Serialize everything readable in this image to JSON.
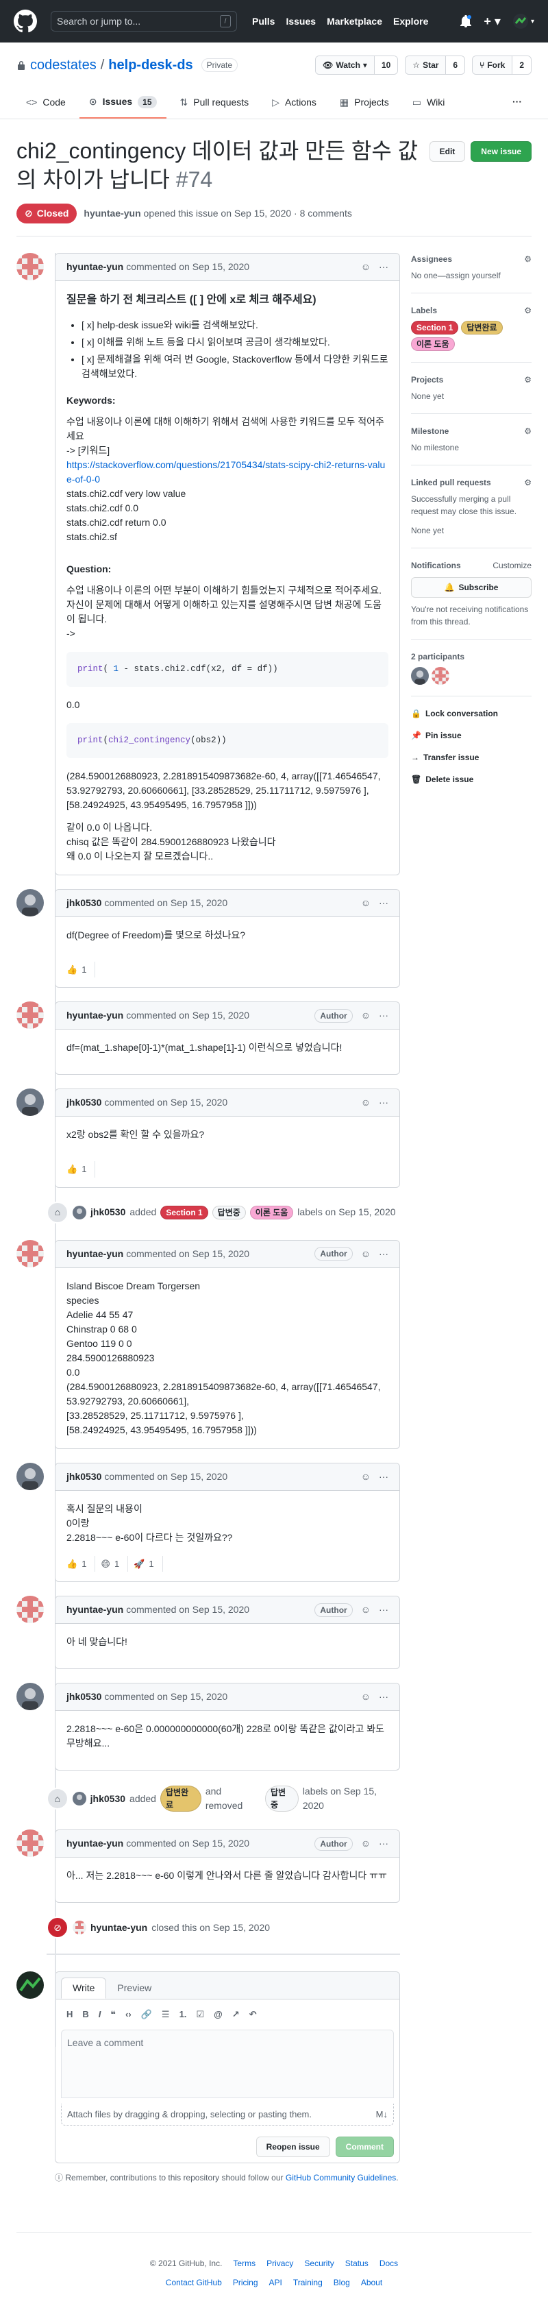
{
  "header": {
    "search_placeholder": "Search or jump to...",
    "search_key": "/",
    "nav": [
      "Pulls",
      "Issues",
      "Marketplace",
      "Explore"
    ]
  },
  "repo": {
    "owner": "codestates",
    "sep": "/",
    "name": "help-desk-ds",
    "visibility": "Private",
    "watch_label": "Watch",
    "watch_count": "10",
    "star_label": "Star",
    "star_count": "6",
    "fork_label": "Fork",
    "fork_count": "2",
    "tabs": [
      {
        "label": "Code"
      },
      {
        "label": "Issues",
        "count": "15"
      },
      {
        "label": "Pull requests"
      },
      {
        "label": "Actions"
      },
      {
        "label": "Projects"
      },
      {
        "label": "Wiki"
      }
    ],
    "more": "···"
  },
  "issue": {
    "title": "chi2_contingency 데이터 값과 만든 함수 값의 차이가 납니다",
    "number": "#74",
    "edit_label": "Edit",
    "new_issue_label": "New issue",
    "state": "Closed",
    "opener": "hyuntae-yun",
    "opened_text": "opened this issue on Sep 15, 2020 · 8 comments"
  },
  "first_comment": {
    "author": "hyuntae-yun",
    "meta": "commented on Sep 15, 2020",
    "heading": "질문을 하기 전 체크리스트 ([ ] 안에 x로 체크 해주세요)",
    "checklist": [
      "[ x] help-desk issue와 wiki를 검색해보았다.",
      "[ x] 이해를 위해 노트 등을 다시 읽어보며 공금이 생각해보았다.",
      "[ x] 문제해결을 위해 여러 번 Google, Stackoverflow 등에서 다양한 키워드로 검색해보았다."
    ],
    "keywords_heading": "Keywords:",
    "keywords_intro": "수업 내용이나 이론에 대해 이해하기 위해서 검색에 사용한 키워드를 모두 적어주세요",
    "keywords_arrow": "-> [키워드]",
    "keywords_link": "https://stackoverflow.com/questions/21705434/stats-scipy-chi2-returns-value-of-0-0",
    "keywords": [
      "stats.chi2.cdf very low value",
      "stats.chi2.cdf 0.0",
      "stats.chi2.cdf return 0.0",
      "stats.chi2.sf"
    ],
    "question_heading": "Question:",
    "question_text": "수업 내용이나 이론의 어떤 부분이 이해하기 힘들었는지 구체적으로 적어주세요. 자신이 문제에 대해서 어떻게 이해하고 있는지를 설명해주시면 답변 채공에 도움이 됩니다.",
    "question_arrow": "->",
    "code1": {
      "a": "print",
      "b": "( ",
      "c": "1",
      "d": " - stats.chi2.cdf(x2, df = df))"
    },
    "result1": "0.0",
    "code2": {
      "a": "print",
      "b": "(",
      "c": "chi2_contingency",
      "d": "(obs2))"
    },
    "result2": "(284.5900126880923, 2.2818915409873682e-60, 4, array([[71.46546547, 53.92792793, 20.60660661], [33.28528529, 25.11711712, 9.5975976 ], [58.24924925, 43.95495495, 16.7957958 ]]))",
    "closing": [
      "같이 0.0 이 나옵니다.",
      "chisq 값은 똑같이 284.5900126880923 나왔습니다",
      "왜 0.0 이 나오는지 잘 모르겠습니다.."
    ]
  },
  "comments": [
    {
      "author": "jhk0530",
      "meta": "commented on Sep 15, 2020",
      "role": "",
      "lines": [
        "df(Degree of Freedom)를 몇으로 하셨나요?"
      ],
      "reactions": [
        {
          "emoji": "👍",
          "count": "1"
        }
      ]
    },
    {
      "author": "hyuntae-yun",
      "meta": "commented on Sep 15, 2020",
      "role": "Author",
      "lines": [
        "df=(mat_1.shape[0]-1)*(mat_1.shape[1]-1) 이런식으로 넣었습니다!"
      ],
      "reactions": []
    },
    {
      "author": "jhk0530",
      "meta": "commented on Sep 15, 2020",
      "role": "",
      "lines": [
        "x2랑 obs2를 확인 할 수 있을까요?"
      ],
      "reactions": [
        {
          "emoji": "👍",
          "count": "1"
        }
      ]
    }
  ],
  "label_event1": {
    "actor": "jhk0530",
    "verb": "added",
    "labels": [
      "Section 1",
      "답변중",
      "이론 도움"
    ],
    "tail": "labels on Sep 15, 2020"
  },
  "comment_data": {
    "author": "hyuntae-yun",
    "meta": "commented on Sep 15, 2020",
    "role": "Author",
    "lines": [
      "Island Biscoe Dream Torgersen",
      "species",
      "Adelie 44 55 47",
      "Chinstrap 0 68 0",
      "Gentoo 119 0 0",
      "284.5900126880923",
      "0.0",
      "(284.5900126880923, 2.2818915409873682e-60, 4, array([[71.46546547, 53.92792793, 20.60660661],",
      "[33.28528529, 25.11711712, 9.5975976 ],",
      "[58.24924925, 43.95495495, 16.7957958 ]]))"
    ]
  },
  "comments2": [
    {
      "author": "jhk0530",
      "meta": "commented on Sep 15, 2020",
      "role": "",
      "lines": [
        "혹시 질문의 내용이",
        "0이랑",
        "2.2818~~~ e-60이 다르다 는 것일까요??"
      ],
      "reactions": [
        {
          "emoji": "👍",
          "count": "1"
        },
        {
          "emoji": "😄",
          "count": "1"
        },
        {
          "emoji": "🚀",
          "count": "1"
        }
      ]
    },
    {
      "author": "hyuntae-yun",
      "meta": "commented on Sep 15, 2020",
      "role": "Author",
      "lines": [
        "아 네 맞습니다!"
      ],
      "reactions": []
    },
    {
      "author": "jhk0530",
      "meta": "commented on Sep 15, 2020",
      "role": "",
      "lines": [
        "2.2818~~~ e-60은 0.000000000000(60개) 228로 0이랑 똑같은 값이라고 봐도 무방해요..."
      ],
      "reactions": []
    }
  ],
  "label_event2": {
    "actor": "jhk0530",
    "added": "added",
    "label_added": "답변완료",
    "removed": "and removed",
    "label_removed": "답변중",
    "tail": "labels on Sep 15, 2020"
  },
  "last_comment": {
    "author": "hyuntae-yun",
    "meta": "commented on Sep 15, 2020",
    "role": "Author",
    "lines": [
      "아... 저는 2.2818~~~ e-60 이렇게 안나와서 다른 줄 알았습니다 감사합니다 ㅠㅠ"
    ]
  },
  "close_event": {
    "actor": "hyuntae-yun",
    "text": "closed this on Sep 15, 2020"
  },
  "new_comment": {
    "tab_write": "Write",
    "tab_preview": "Preview",
    "toolbar": [
      "H",
      "B",
      "I",
      "❝",
      "‹›",
      "🔗",
      "☰",
      "1.",
      "☑",
      "@",
      "↗",
      "↶"
    ],
    "placeholder": "Leave a comment",
    "hint": "Attach files by dragging & dropping, selecting or pasting them.",
    "reopen_label": "Reopen issue",
    "comment_label": "Comment",
    "remember_prefix": "Remember, contributions to this repository should follow our",
    "remember_link": "GitHub Community Guidelines",
    "remember_suffix": "."
  },
  "sidebar": {
    "assignees_title": "Assignees",
    "assignees_value": "No one—assign yourself",
    "labels_title": "Labels",
    "labels": [
      "Section 1",
      "답변완료",
      "이론 도움"
    ],
    "projects_title": "Projects",
    "projects_value": "None yet",
    "milestone_title": "Milestone",
    "milestone_value": "No milestone",
    "linked_title": "Linked pull requests",
    "linked_desc": "Successfully merging a pull request may close this issue.",
    "linked_value": "None yet",
    "notifications_title": "Notifications",
    "customize": "Customize",
    "subscribe_label": "Subscribe",
    "notif_desc": "You're not receiving notifications from this thread.",
    "participants_title": "2 participants",
    "actions": [
      "Lock conversation",
      "Pin issue",
      "Transfer issue",
      "Delete issue"
    ]
  },
  "footer": {
    "copyright": "© 2021 GitHub, Inc.",
    "row1": [
      "Terms",
      "Privacy",
      "Security",
      "Status",
      "Docs"
    ],
    "row2": [
      "Contact GitHub",
      "Pricing",
      "API",
      "Training",
      "Blog",
      "About"
    ]
  },
  "colors": {
    "label_section1": "#d73a4a",
    "label_answering": "#fbca04",
    "label_theory": "#f9a8d4",
    "label_done": "#e4c46c",
    "closed": "#cb2431",
    "new_issue": "#2ea44f"
  }
}
